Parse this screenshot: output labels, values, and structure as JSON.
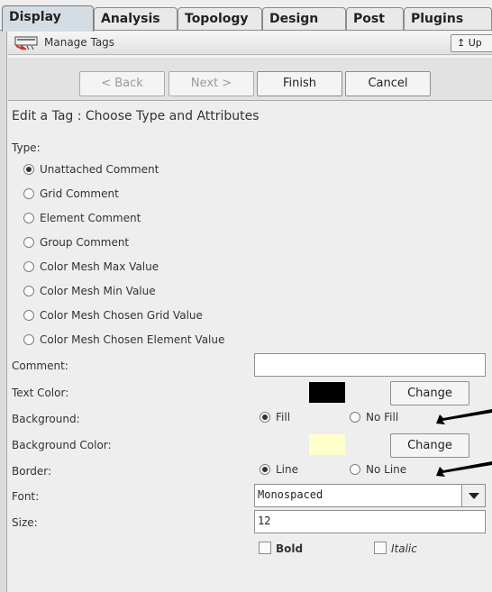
{
  "tabs": [
    {
      "label": "Display",
      "active": true
    },
    {
      "label": "Analysis",
      "active": false
    },
    {
      "label": "Topology",
      "active": false
    },
    {
      "label": "Design",
      "active": false
    },
    {
      "label": "Post",
      "active": false
    },
    {
      "label": "Plugins",
      "active": false
    }
  ],
  "titlebar": {
    "title": "Manage Tags",
    "up_label": "↥ Up",
    "icon": "tag-icon"
  },
  "wizard": {
    "back": "< Back",
    "next": "Next >",
    "finish": "Finish",
    "cancel": "Cancel"
  },
  "heading": "Edit a Tag : Choose Type and Attributes",
  "type_label": "Type:",
  "type_options": [
    {
      "label": "Unattached Comment",
      "checked": true
    },
    {
      "label": "Grid Comment",
      "checked": false
    },
    {
      "label": "Element Comment",
      "checked": false
    },
    {
      "label": "Group Comment",
      "checked": false
    },
    {
      "label": "Color Mesh Max Value",
      "checked": false
    },
    {
      "label": "Color Mesh Min Value",
      "checked": false
    },
    {
      "label": "Color Mesh Chosen Grid Value",
      "checked": false
    },
    {
      "label": "Color Mesh Chosen Element Value",
      "checked": false
    }
  ],
  "comment": {
    "label": "Comment:",
    "value": ""
  },
  "text_color": {
    "label": "Text Color:",
    "color": "#000000",
    "change": "Change"
  },
  "background": {
    "label": "Background:",
    "fill": "Fill",
    "no_fill": "No Fill",
    "selected": "fill"
  },
  "background_color": {
    "label": "Background Color:",
    "color": "#ffffcc",
    "change": "Change"
  },
  "border": {
    "label": "Border:",
    "line": "Line",
    "no_line": "No Line",
    "selected": "line"
  },
  "font": {
    "label": "Font:",
    "value": "Monospaced"
  },
  "size": {
    "label": "Size:",
    "value": "12"
  },
  "style": {
    "bold": "Bold",
    "italic": "Italic",
    "bold_checked": false,
    "italic_checked": false
  }
}
